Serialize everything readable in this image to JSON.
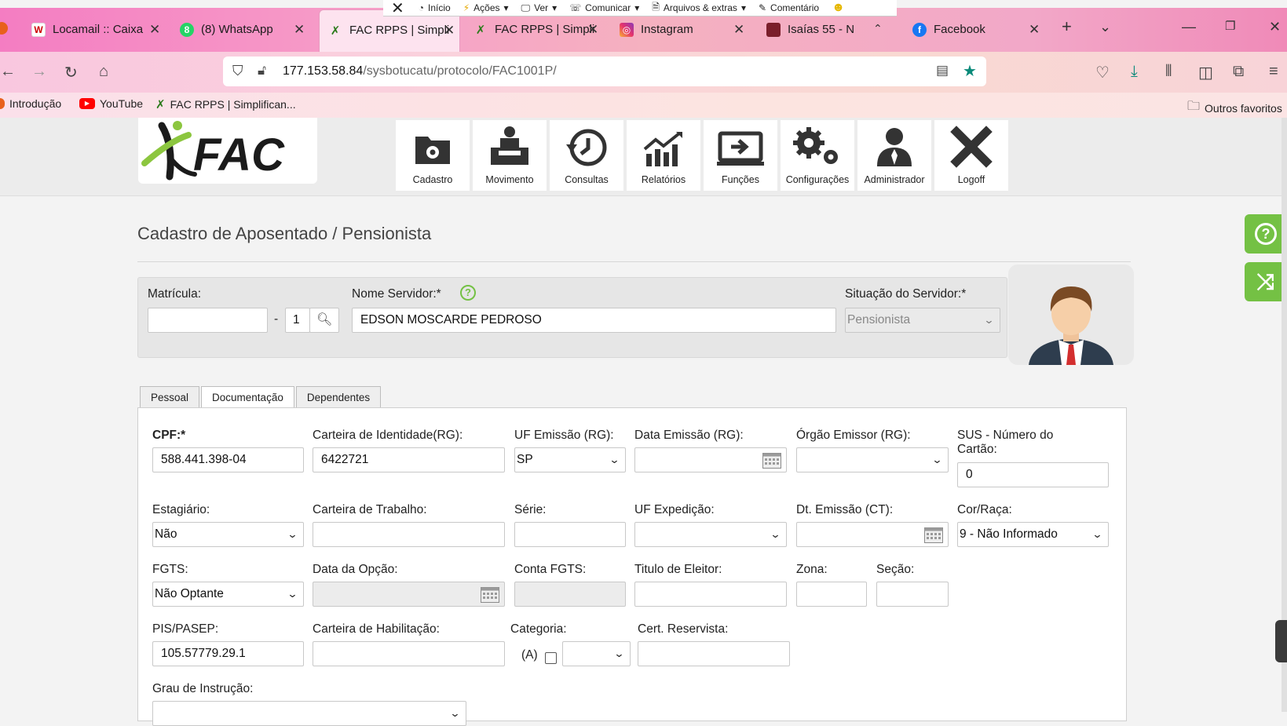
{
  "meeting_bar": {
    "items": [
      "Início",
      "Ações",
      "Ver",
      "Comunicar",
      "Arquivos & extras",
      "Comentário"
    ]
  },
  "browser": {
    "tabs": [
      {
        "label": "Locamail :: Caixa",
        "icon": "W"
      },
      {
        "label": "(8) WhatsApp",
        "icon": "whatsapp"
      },
      {
        "label": "FAC RPPS | Simpli",
        "icon": "fac"
      },
      {
        "label": "FAC RPPS | Simpli",
        "icon": "fac"
      },
      {
        "label": "Instagram",
        "icon": "instagram"
      },
      {
        "label": "Isaías 55 - N",
        "icon": "bible"
      },
      {
        "label": "Facebook",
        "icon": "facebook"
      }
    ],
    "url_host": "177.153.58.84",
    "url_path": "/sysbotucatu/protocolo/FAC1001P/",
    "bookmarks": [
      {
        "label": "Introdução"
      },
      {
        "label": "YouTube"
      },
      {
        "label": "FAC RPPS | Simplifican..."
      }
    ],
    "other_bookmarks": "Outros favoritos"
  },
  "app": {
    "logo_text": "FAC",
    "menu": [
      "Cadastro",
      "Movimento",
      "Consultas",
      "Relatórios",
      "Funções",
      "Configurações",
      "Administrador",
      "Logoff"
    ]
  },
  "page": {
    "title": "Cadastro de Aposentado / Pensionista",
    "matricula_label": "Matrícula:",
    "matricula_value": "",
    "dash": "-",
    "matricula_digit": "1",
    "nome_label": "Nome Servidor:*",
    "nome_value": "EDSON MOSCARDE PEDROSO",
    "situacao_label": "Situação do Servidor:*",
    "situacao_value": "Pensionista"
  },
  "tabs": [
    "Pessoal",
    "Documentação",
    "Dependentes"
  ],
  "form": {
    "cpf_label": "CPF:*",
    "cpf_value": "588.441.398-04",
    "rg_label": "Carteira de Identidade(RG):",
    "rg_value": "6422721",
    "uf_emissao_label": "UF Emissão (RG):",
    "uf_emissao_value": "SP",
    "data_emissao_label": "Data Emissão (RG):",
    "orgao_label": "Órgão Emissor (RG):",
    "sus_label_1": "SUS - Número do",
    "sus_label_2": "Cartão:",
    "sus_value": "0",
    "estagiario_label": "Estagiário:",
    "estagiario_value": "Não",
    "ctps_label": "Carteira de Trabalho:",
    "serie_label": "Série:",
    "uf_exp_label": "UF Expedição:",
    "dt_emissao_ct_label": "Dt. Emissão (CT):",
    "cor_label": "Cor/Raça:",
    "cor_value": "9 - Não Informado",
    "fgts_label": "FGTS:",
    "fgts_value": "Não Optante",
    "data_opcao_label": "Data da Opção:",
    "conta_fgts_label": "Conta FGTS:",
    "titulo_label": "Titulo de Eleitor:",
    "zona_label": "Zona:",
    "secao_label": "Seção:",
    "pis_label": "PIS/PASEP:",
    "pis_value": "105.57779.29.1",
    "cnh_label": "Carteira de Habilitação:",
    "categoria_label": "Categoria:",
    "categoria_a": "(A)",
    "reservista_label": "Cert. Reservista:",
    "grau_label": "Grau de Instrução:"
  }
}
